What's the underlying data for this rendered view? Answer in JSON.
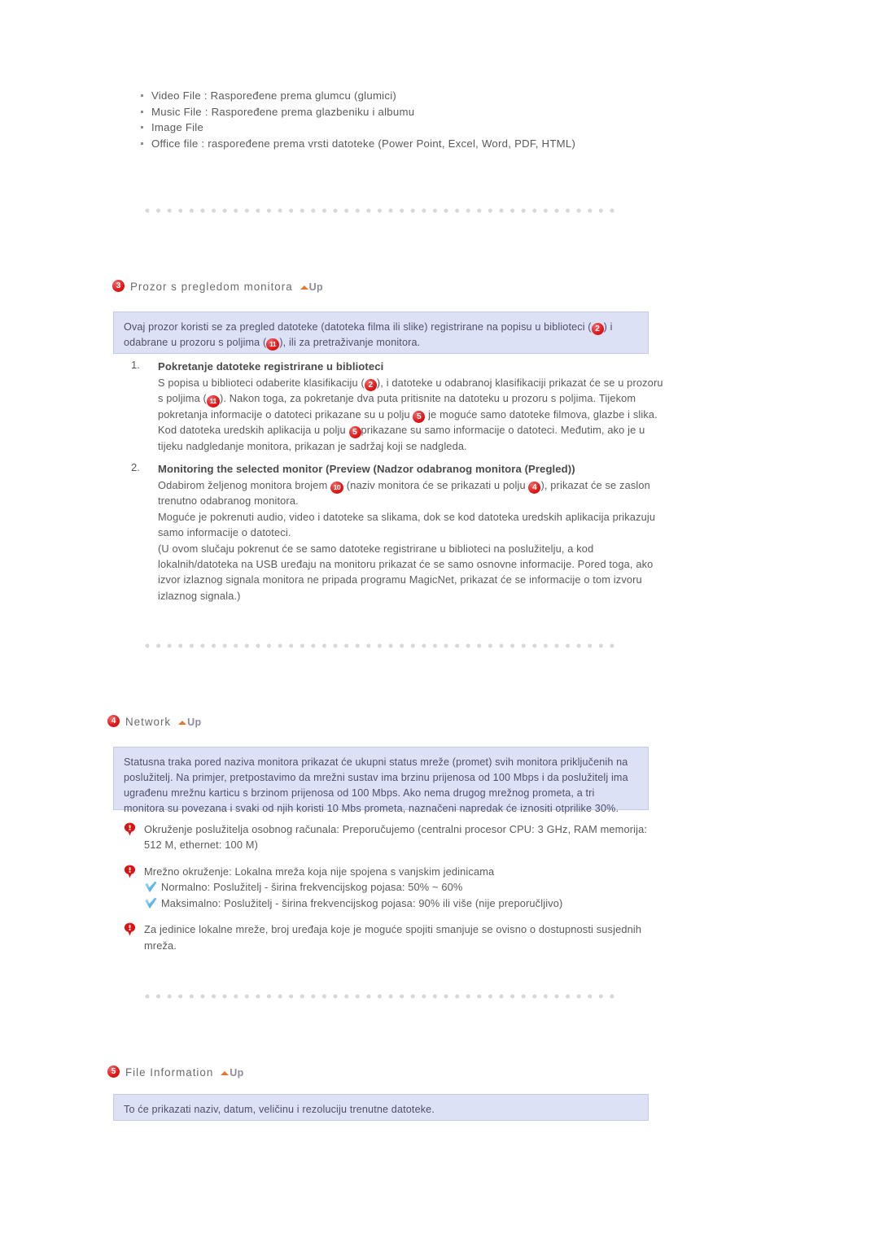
{
  "document": {
    "language": "hr",
    "text_color": "#58585a",
    "infobox_bg": "#dde1f5",
    "infobox_border": "#c3c9ea",
    "badge_color": "#e01a1a",
    "uplink_arrow_color": "#e8762a",
    "uplink_text_color": "#8a8c9e"
  },
  "top_bullets": [
    "Video File : Raspoređene prema glumcu (glumici)",
    "Music File : Raspoređene prema glazbeniku i albumu",
    "Image File",
    "Office file : raspoređene prema vrsti datoteke (Power Point, Excel, Word, PDF, HTML)"
  ],
  "section_preview": {
    "badge": "3",
    "title": "Prozor s pregledom monitora",
    "up_label": "Up",
    "infobox": {
      "part1": "Ovaj prozor koristi se za pregled datoteke (datoteka filma ili slike) registrirane na popisu u biblioteci (",
      "badge1": "2",
      "part2": ") i odabrane u prozoru s poljima (",
      "badge2": "11",
      "part3": "), ili za pretraživanje monitora."
    },
    "steps": [
      {
        "number": "1.",
        "title": "Pokretanje datoteke registrirane u biblioteci",
        "body_part1": "S popisa u biblioteci odaberite klasifikaciju (",
        "badge1": "2",
        "body_part2": "), i datoteke u odabranoj klasifikaciji prikazat će se u prozoru s poljima (",
        "badge2": "11",
        "body_part3": "). Nakon toga, za pokretanje dva puta pritisnite na datoteku u prozoru s poljima. Tijekom pokretanja informacije o datoteci prikazane su u polju ",
        "badge3": "5",
        "body_part4": " je moguće samo datoteke filmova, glazbe i slika. Kod datoteka uredskih aplikacija u polju ",
        "badge4": "5",
        "body_part5": "prikazane su samo informacije o datoteci. Međutim, ako je u tijeku nadgledanje monitora, prikazan je sadržaj koji se nadgleda."
      },
      {
        "number": "2.",
        "title": "Monitoring the selected monitor (Preview (Nadzor odabranog monitora (Pregled))",
        "body_part1": "Odabirom željenog monitora brojem ",
        "badge1": "10",
        "body_part2": " (naziv monitora će se prikazati u polju ",
        "badge2": "4",
        "body_part3": "), prikazat će se zaslon trenutno odabranog monitora.",
        "body_part4": "Moguće je pokrenuti audio, video i datoteke sa slikama, dok se kod datoteka uredskih aplikacija prikazuju samo informacije o datoteci.",
        "body_part5": "(U ovom slučaju pokrenut će se samo datoteke registrirane u biblioteci na poslužitelju, a kod lokalnih/datoteka na USB uređaju na monitoru prikazat će se samo osnovne informacije. Pored toga, ako izvor izlaznog signala monitora ne pripada programu MagicNet, prikazat će se informacije o tom izvoru izlaznog signala.)"
      }
    ]
  },
  "section_network": {
    "badge": "4",
    "title": "Network",
    "up_label": "Up",
    "infobox_text": "Statusna traka pored naziva monitora prikazat će ukupni status mreže (promet) svih monitora priključenih na poslužitelj. Na primjer, pretpostavimo da mrežni sustav ima brzinu prijenosa od 100 Mbps i da poslužitelj ima ugrađenu mrežnu karticu s brzinom prijenosa od 100 Mbps. Ako nema drugog mrežnog prometa, a tri monitora su povezana i svaki od njih koristi 10 Mbs prometa, naznačeni napredak će iznositi otprilike 30%.",
    "notes": [
      {
        "icon": "alert-icon",
        "text": "Okruženje poslužitelja osobnog računala: Preporučujemo (centralni procesor CPU: 3 GHz, RAM memorija: 512 M, ethernet: 100 M)",
        "sub_lines": []
      },
      {
        "icon": "alert-icon",
        "text": "Mrežno okruženje: Lokalna mreža koja nije spojena s vanjskim jedinicama",
        "sub_lines": [
          "Normalno: Poslužitelj - širina frekvencijskog pojasa: 50% ~ 60%",
          "Maksimalno: Poslužitelj - širina frekvencijskog pojasa: 90% ili više (nije preporučljivo)"
        ]
      },
      {
        "icon": "alert-icon",
        "text": "Za jedinice lokalne mreže, broj uređaja koje je moguće spojiti smanjuje se ovisno o dostupnosti susjednih mreža.",
        "sub_lines": []
      }
    ]
  },
  "section_file_information": {
    "badge": "5",
    "title": "File Information",
    "up_label": "Up",
    "infobox_text": "To će prikazati naziv, datum, veličinu i rezoluciju trenutne datoteke."
  }
}
